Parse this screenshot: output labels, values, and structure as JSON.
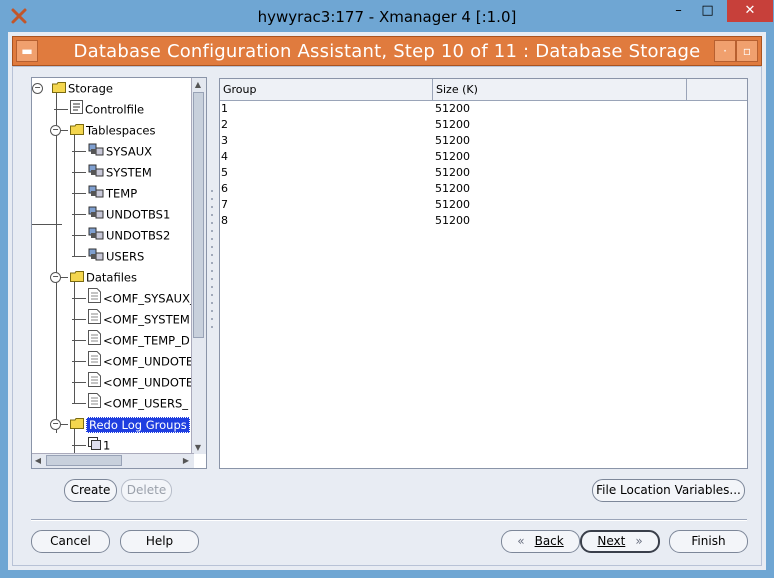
{
  "window": {
    "title": "hywyrac3:177 - Xmanager 4 [:1.0]",
    "controls": {
      "minimize": "–",
      "maximize": "□",
      "close": "✕"
    }
  },
  "dialog": {
    "title": "Database Configuration Assistant, Step 10 of 11 : Database Storage"
  },
  "tree": {
    "items": [
      {
        "label": "Storage",
        "icon": "folder-icon"
      },
      {
        "label": "Controlfile",
        "icon": "controlfile-icon"
      },
      {
        "label": "Tablespaces",
        "icon": "folder-icon"
      },
      {
        "label": "SYSAUX",
        "icon": "tablespace-icon"
      },
      {
        "label": "SYSTEM",
        "icon": "tablespace-icon"
      },
      {
        "label": "TEMP",
        "icon": "tablespace-icon"
      },
      {
        "label": "UNDOTBS1",
        "icon": "tablespace-icon"
      },
      {
        "label": "UNDOTBS2",
        "icon": "tablespace-icon"
      },
      {
        "label": "USERS",
        "icon": "tablespace-icon"
      },
      {
        "label": "Datafiles",
        "icon": "folder-icon"
      },
      {
        "label": "<OMF_SYSAUX_",
        "icon": "datafile-icon"
      },
      {
        "label": "<OMF_SYSTEM",
        "icon": "datafile-icon"
      },
      {
        "label": "<OMF_TEMP_D",
        "icon": "datafile-icon"
      },
      {
        "label": "<OMF_UNDOTE",
        "icon": "datafile-icon"
      },
      {
        "label": "<OMF_UNDOTE",
        "icon": "datafile-icon"
      },
      {
        "label": "<OMF_USERS_",
        "icon": "datafile-icon"
      },
      {
        "label": "Redo Log Groups",
        "icon": "folder-icon",
        "selected": true
      },
      {
        "label": "1",
        "icon": "redolog-icon"
      }
    ]
  },
  "table": {
    "columns": [
      "Group",
      "Size (K)"
    ],
    "rows": [
      [
        "1",
        "51200"
      ],
      [
        "2",
        "51200"
      ],
      [
        "3",
        "51200"
      ],
      [
        "4",
        "51200"
      ],
      [
        "5",
        "51200"
      ],
      [
        "6",
        "51200"
      ],
      [
        "7",
        "51200"
      ],
      [
        "8",
        "51200"
      ]
    ]
  },
  "buttons": {
    "create": "Create",
    "delete": "Delete",
    "file_location": "File Location Variables...",
    "cancel": "Cancel",
    "help": "Help",
    "back": "Back",
    "next": "Next",
    "finish": "Finish"
  },
  "colors": {
    "title_bar": "#6fa6d3",
    "dialog_title": "#e07b3e",
    "selection": "#1e3ee0",
    "close_button": "#c7403a"
  }
}
